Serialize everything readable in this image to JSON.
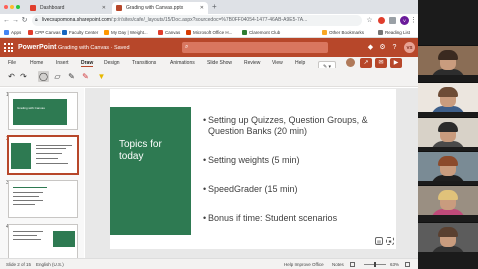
{
  "browser": {
    "tabs": [
      {
        "title": "Dashboard",
        "favicon_color": "#e03e2d"
      },
      {
        "title": "Grading with Canvas.pptx",
        "favicon_color": "#b7472a"
      }
    ],
    "new_tab_glyph": "+",
    "close_glyph": "✕",
    "url_host": "livecsupomona.sharepoint.com",
    "url_path": "/:p:/r/sites/cafe/_layouts/15/Doc.aspx?sourcedoc=%7B0FF04054-1477-46AB-A9E5-7A...",
    "bookmarks": [
      {
        "label": "Apps",
        "color": "#4285f4"
      },
      {
        "label": "CPP Canvas",
        "color": "#e03e2d"
      },
      {
        "label": "Faculty Center",
        "color": "#1565c0"
      },
      {
        "label": "My Day | Weight...",
        "color": "#ff9800"
      },
      {
        "label": "Canvas",
        "color": "#e03e2d"
      },
      {
        "label": "Microsoft Office H...",
        "color": "#d83b01"
      },
      {
        "label": "Claremont Club",
        "color": "#2e7d32"
      },
      {
        "label": "Other Bookmarks",
        "color": "#f9a825"
      },
      {
        "label": "Reading List",
        "color": "#757575"
      }
    ]
  },
  "office": {
    "app_name": "PowerPoint",
    "doc_title": "Grading with Canvas ",
    "doc_status": "· Saved",
    "user_initials": "VS",
    "brand_color": "#b7472a"
  },
  "ribbon": {
    "tabs": [
      "File",
      "Home",
      "Insert",
      "Draw",
      "Design",
      "Transitions",
      "Animations",
      "Slide Show",
      "Review",
      "View",
      "Help"
    ],
    "active_tab": "Draw",
    "pen_glyph": "✎",
    "caret": "▾"
  },
  "thumbnails": [
    {
      "num": "1",
      "title": "Grading with Canvas"
    },
    {
      "num": "2",
      "title": "Topics for today"
    },
    {
      "num": "3",
      "title": ""
    },
    {
      "num": "4",
      "title": ""
    }
  ],
  "slide": {
    "title": "Topics for today",
    "bullets": [
      "Setting up Quizzes, Question Groups, & Question Banks (20 min)",
      "Setting weights (5 min)",
      "SpeedGrader (15 min)",
      "Bonus if time:  Student scenarios"
    ],
    "bullet_glyph": "•",
    "green": "#2e7a52"
  },
  "status": {
    "slide_of": "Slide 2 of 15",
    "language": "English (U.S.)",
    "help": "Help Improve Office",
    "notes": "Notes",
    "zoom": "63%"
  },
  "participants": [
    {
      "name": "",
      "bg": "#8a6d55",
      "hair": "#3a2a20",
      "shirt": "#2d2d2d"
    },
    {
      "name": "",
      "bg": "#ece6df",
      "hair": "#6d4c36",
      "shirt": "#3e5f8a"
    },
    {
      "name": "",
      "bg": "#d8d2c8",
      "hair": "#2b2b2b",
      "shirt": "#4a4a4a"
    },
    {
      "name": "",
      "bg": "#c9c3b8",
      "hair": "#d9b98a",
      "shirt": "#7f9fbf"
    },
    {
      "name": "",
      "bg": "#7a8b95",
      "hair": "#8b4a2b",
      "shirt": "#1f1f1f"
    },
    {
      "name": "",
      "bg": "#9a8f82",
      "hair": "#e0c27a",
      "shirt": "#c04a7a"
    },
    {
      "name": "",
      "bg": "#5c5c5c",
      "hair": "#5a4030",
      "shirt": "#333"
    }
  ]
}
